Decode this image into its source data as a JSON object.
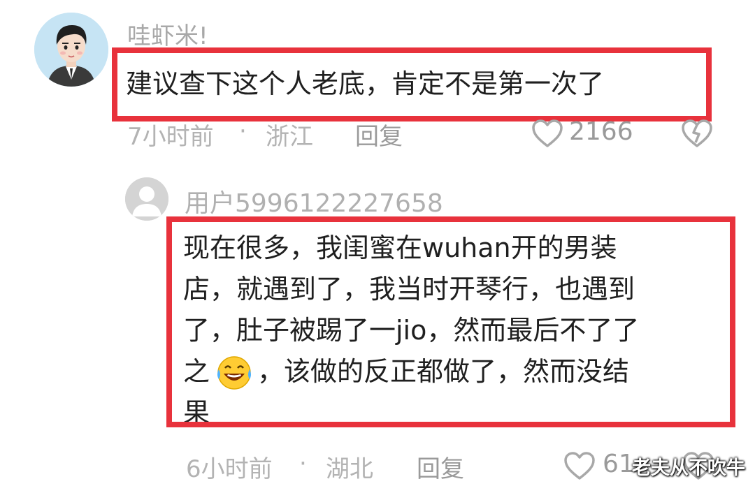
{
  "comment1": {
    "username": "哇虾米!",
    "text": "建议查下这个人老底，肯定不是第一次了",
    "time": "7小时前",
    "separator": "·",
    "location": "浙江",
    "reply_label": "回复",
    "likes": "2166"
  },
  "comment2": {
    "username": "用户5996122227658",
    "text_lines": [
      "现在很多，我闺蜜在wuhan开的男装",
      "店，就遇到了，我当时开琴行，也遇到",
      "了，肚子被踢了一jio，然而最后不了了",
      "之",
      "，该做的反正都做了，然而没结",
      "果"
    ],
    "time": "6小时前",
    "separator": "·",
    "location": "湖北",
    "reply_label": "回复",
    "likes": "61"
  },
  "watermark": "老夫从不吹牛",
  "colors": {
    "highlight_border": "#e8323c",
    "meta_gray": "#b3b3b3",
    "text": "#1f1f1f"
  },
  "icons": [
    "user-avatar-icon",
    "default-avatar-icon",
    "heart-icon",
    "dislike-heart-icon",
    "laughing-emoji-icon"
  ]
}
